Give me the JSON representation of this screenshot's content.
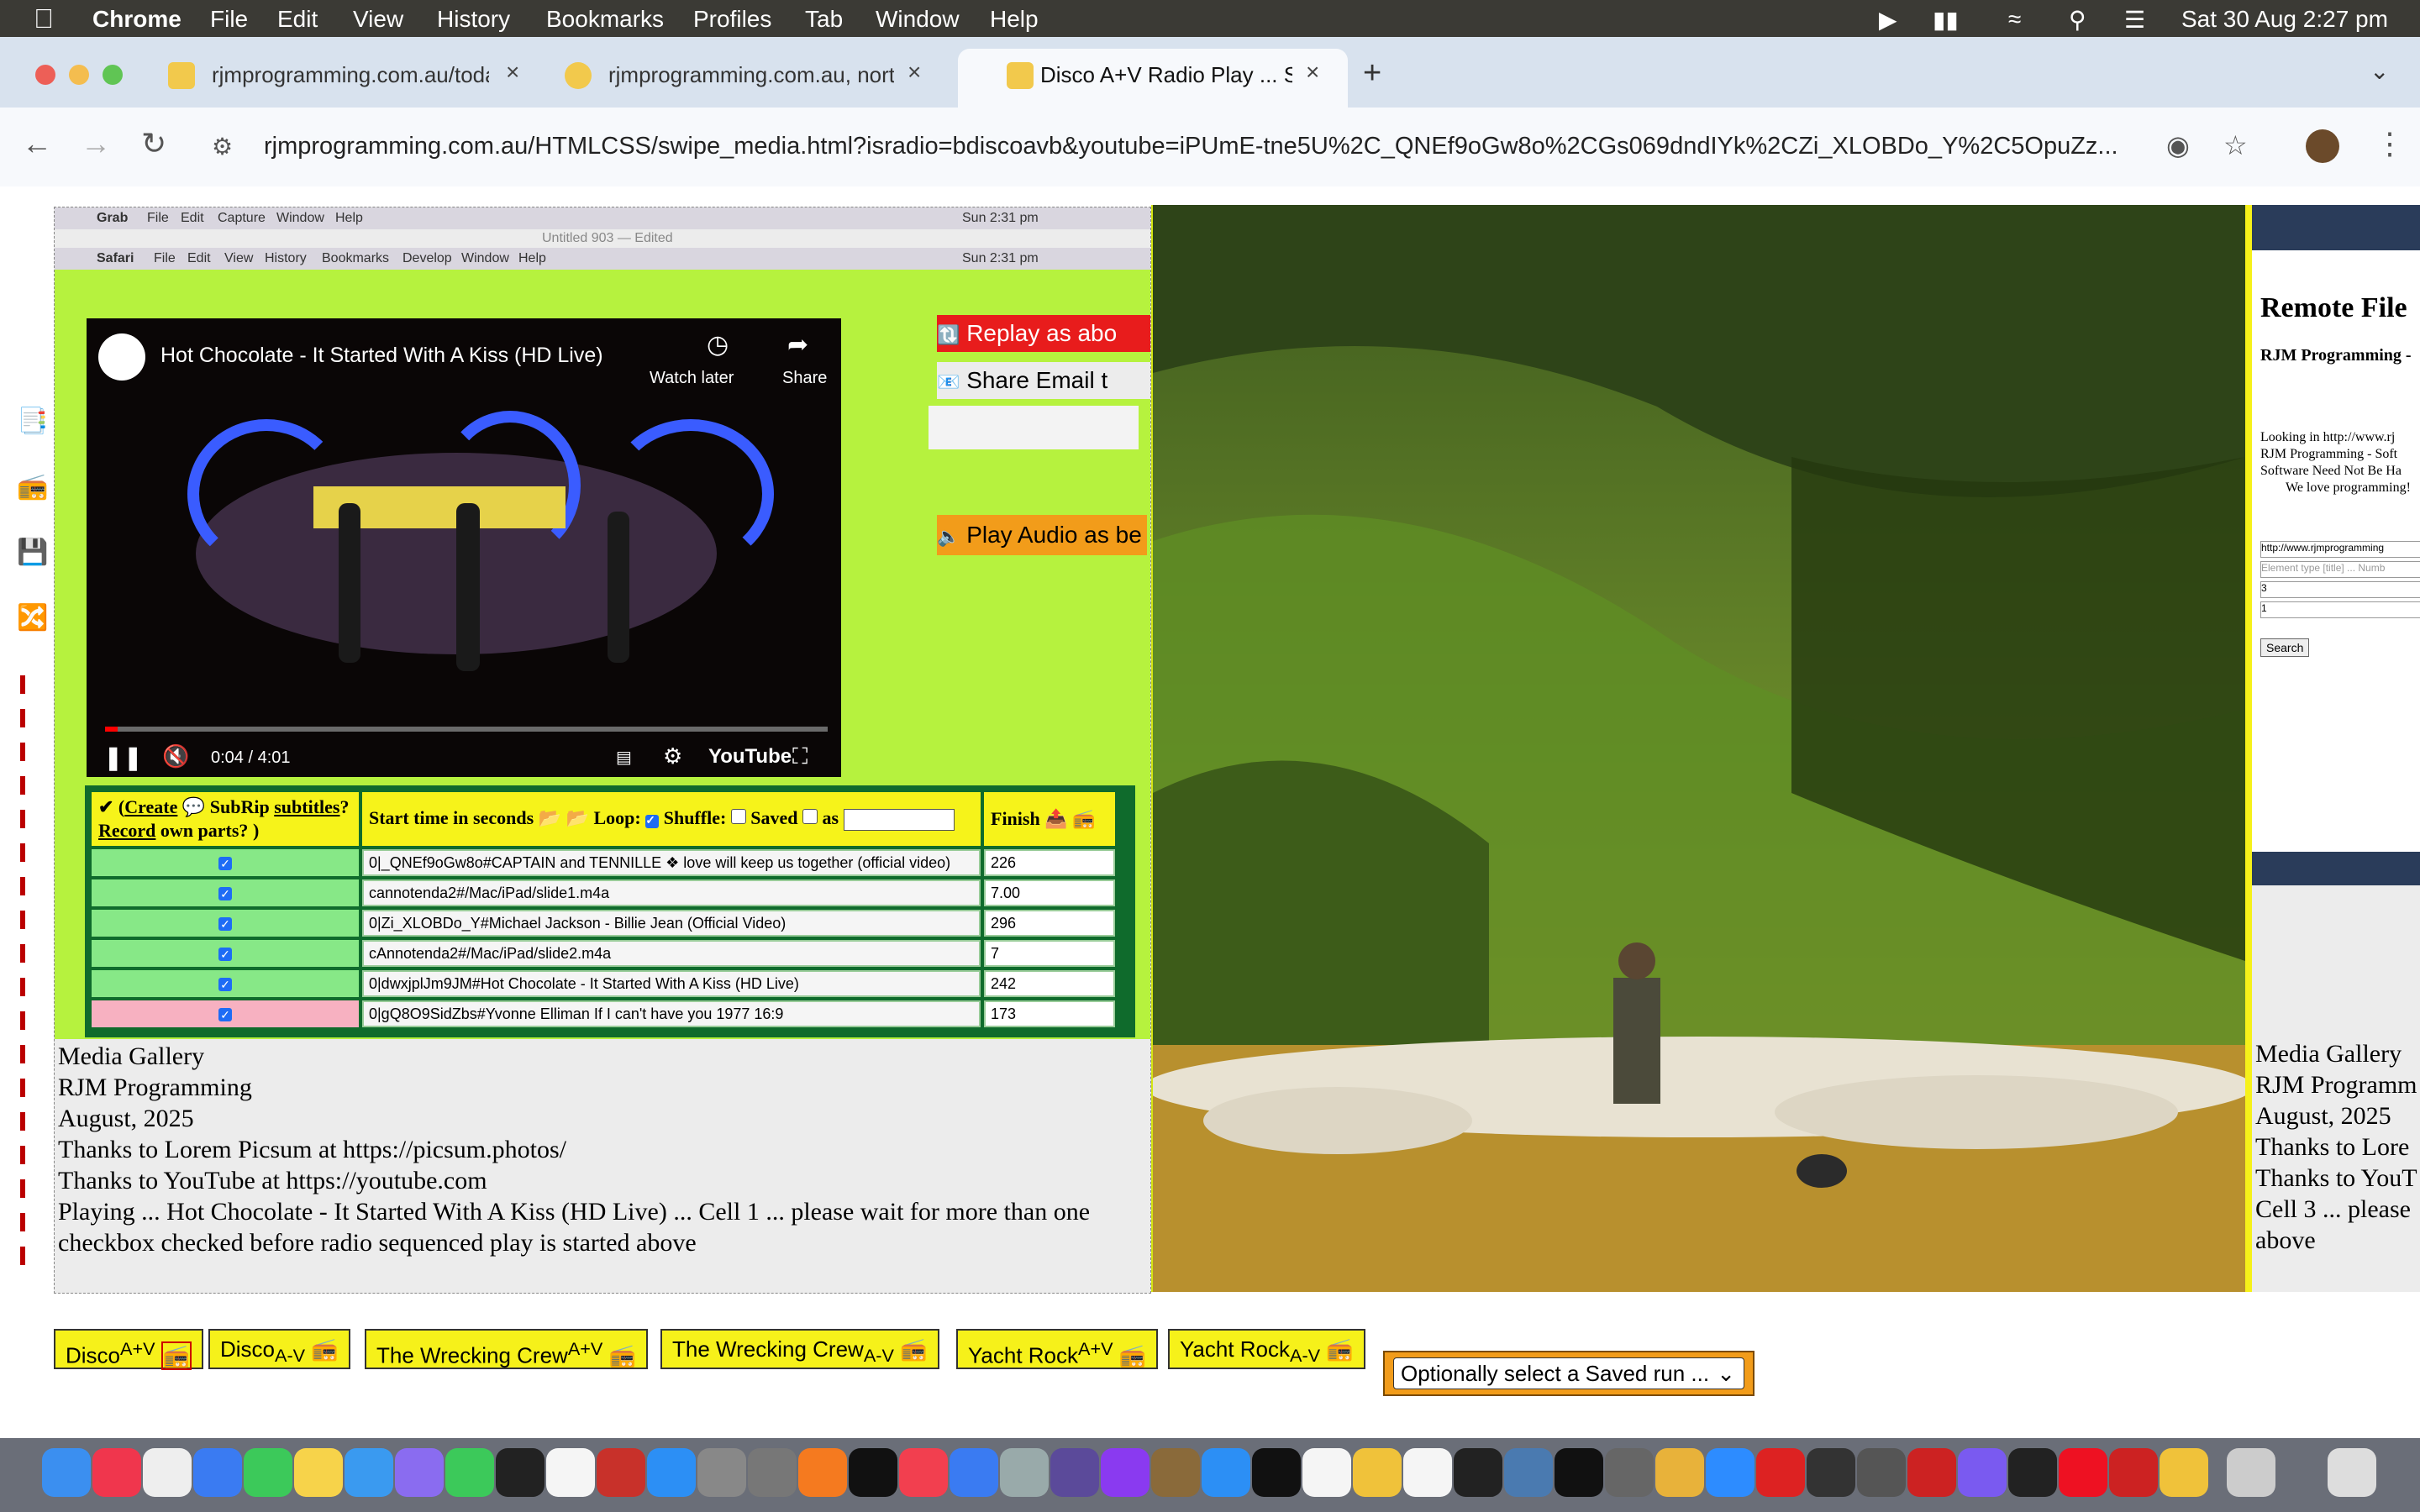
{
  "menubar": {
    "app": "Chrome",
    "items": [
      "File",
      "Edit",
      "View",
      "History",
      "Bookmarks",
      "Profiles",
      "Tab",
      "Window",
      "Help"
    ],
    "clock": "Sat 30 Aug  2:27 pm"
  },
  "tabs": [
    {
      "title": "rjmprogramming.com.au/toda"
    },
    {
      "title": "rjmprogramming.com.au, nort"
    },
    {
      "title": "Disco A+V Radio Play ... S"
    }
  ],
  "address": {
    "url": "rjmprogramming.com.au/HTMLCSS/swipe_media.html?isradio=bdiscoavb&youtube=iPUmE-tne5U%2C_QNEf9oGw8o%2CGs069dndIYk%2CZi_XLOBDo_Y%2C5OpuZz..."
  },
  "inner_screenshot": {
    "grab_menu": [
      "Grab",
      "File",
      "Edit",
      "Capture",
      "Window",
      "Help"
    ],
    "grab_time": "Sun 2:31 pm",
    "untitled": "Untitled 903 — Edited",
    "safari_menu": [
      "Safari",
      "File",
      "Edit",
      "View",
      "History",
      "Bookmarks",
      "Develop",
      "Window",
      "Help"
    ],
    "safari_time": "Sun 2:31 pm"
  },
  "video": {
    "title": "Hot Chocolate - It Started With A Kiss (HD Live)",
    "watch_later": "Watch later",
    "share": "Share",
    "time": "0:04 / 4:01",
    "brand": "YouTube",
    "progress_fraction": 0.017
  },
  "side_buttons": {
    "replay": "Replay as abo",
    "share_email": "Share Email t",
    "play_audio": "Play Audio as be"
  },
  "table": {
    "header_create": "Create",
    "header_subrip": "SubRip",
    "header_subtitles": "subtitles",
    "header_record": "Record",
    "header_own_parts": "own parts?",
    "header_start": "Start time in seconds",
    "header_loop": "Loop:",
    "header_shuffle": "Shuffle:",
    "header_saved": "Saved",
    "header_as": "as",
    "header_finish": "Finish",
    "rows": [
      {
        "title": "0|_QNEf9oGw8o#CAPTAIN and TENNILLE ❖ love will keep us together (official video)",
        "finish": "226"
      },
      {
        "title": "cannotenda2#/Mac/iPad/slide1.m4a",
        "finish": "7.00"
      },
      {
        "title": "0|Zi_XLOBDo_Y#Michael Jackson - Billie Jean (Official Video)",
        "finish": "296"
      },
      {
        "title": "cAnnotenda2#/Mac/iPad/slide2.m4a",
        "finish": "7"
      },
      {
        "title": "0|dwxjplJm9JM#Hot Chocolate - It Started With A Kiss (HD Live)",
        "finish": "242"
      },
      {
        "title": "0|gQ8O9SidZbs#Yvonne Elliman If I can't have you 1977 16:9",
        "finish": "173"
      }
    ]
  },
  "caption1": {
    "line1": "Media Gallery",
    "line2": "RJM Programming",
    "line3": "August, 2025",
    "line4": "Thanks to Lorem Picsum at https://picsum.photos/",
    "line5": "Thanks to YouTube at https://youtube.com",
    "line6": "Playing ... Hot Chocolate - It Started With A Kiss (HD Live) ... Cell 1 ... please wait for more than one checkbox checked before radio sequenced play is started above"
  },
  "cell3": {
    "heading": "Remote File",
    "sub": "RJM Programming -",
    "looking": "Looking in http://www.rj",
    "l2": "RJM Programming - Soft",
    "l3": "Software Need Not Be Ha",
    "l4": "We love programming!",
    "input1": "http://www.rjmprogramming",
    "input2": "Element type [title] ... Numb",
    "input3": "3",
    "input4": "1",
    "search": "Search",
    "cap1": "Media Gallery",
    "cap2": "RJM Programm",
    "cap3": "August, 2025",
    "cap4": "Thanks to Lore",
    "cap5": "Thanks to YouT",
    "cap6": "Cell 3 ... please",
    "cap7": "above"
  },
  "bottom_buttons": {
    "disco_av": "Disco",
    "disco_av_sup": "A+V",
    "disco_a_v": "Disco",
    "disco_a_v_sub": "A-V",
    "wrecking_av": "The Wrecking Crew",
    "wrecking_av_sup": "A+V",
    "wrecking_a_v": "The Wrecking Crew",
    "wrecking_a_v_sub": "A-V",
    "yacht_av": "Yacht Rock",
    "yacht_av_sup": "A+V",
    "yacht_a_v": "Yacht Rock",
    "yacht_a_v_sub": "A-V",
    "saved_select": "Optionally select a Saved run ..."
  },
  "colors": {
    "accent_yellow": "#f6f11a",
    "lime": "#b6f23e",
    "table_green": "#0f6b2c"
  }
}
